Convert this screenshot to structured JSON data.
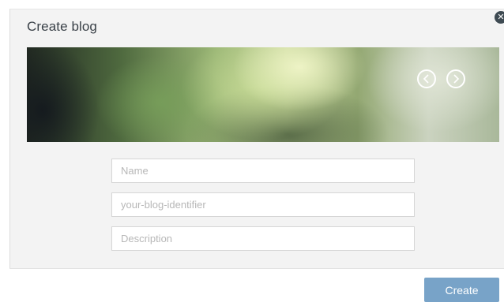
{
  "dialog": {
    "title": "Create blog",
    "close_icon": "close-icon"
  },
  "banner": {
    "prev_icon": "chevron-left-icon",
    "next_icon": "chevron-right-icon"
  },
  "form": {
    "name_placeholder": "Name",
    "name_value": "",
    "identifier_placeholder": "your-blog-identifier",
    "identifier_value": "",
    "description_placeholder": "Description",
    "description_value": ""
  },
  "footer": {
    "create_label": "Create"
  },
  "colors": {
    "dialog_bg": "#f3f3f3",
    "button_bg": "#78a3c8",
    "title_text": "#3a4148"
  }
}
